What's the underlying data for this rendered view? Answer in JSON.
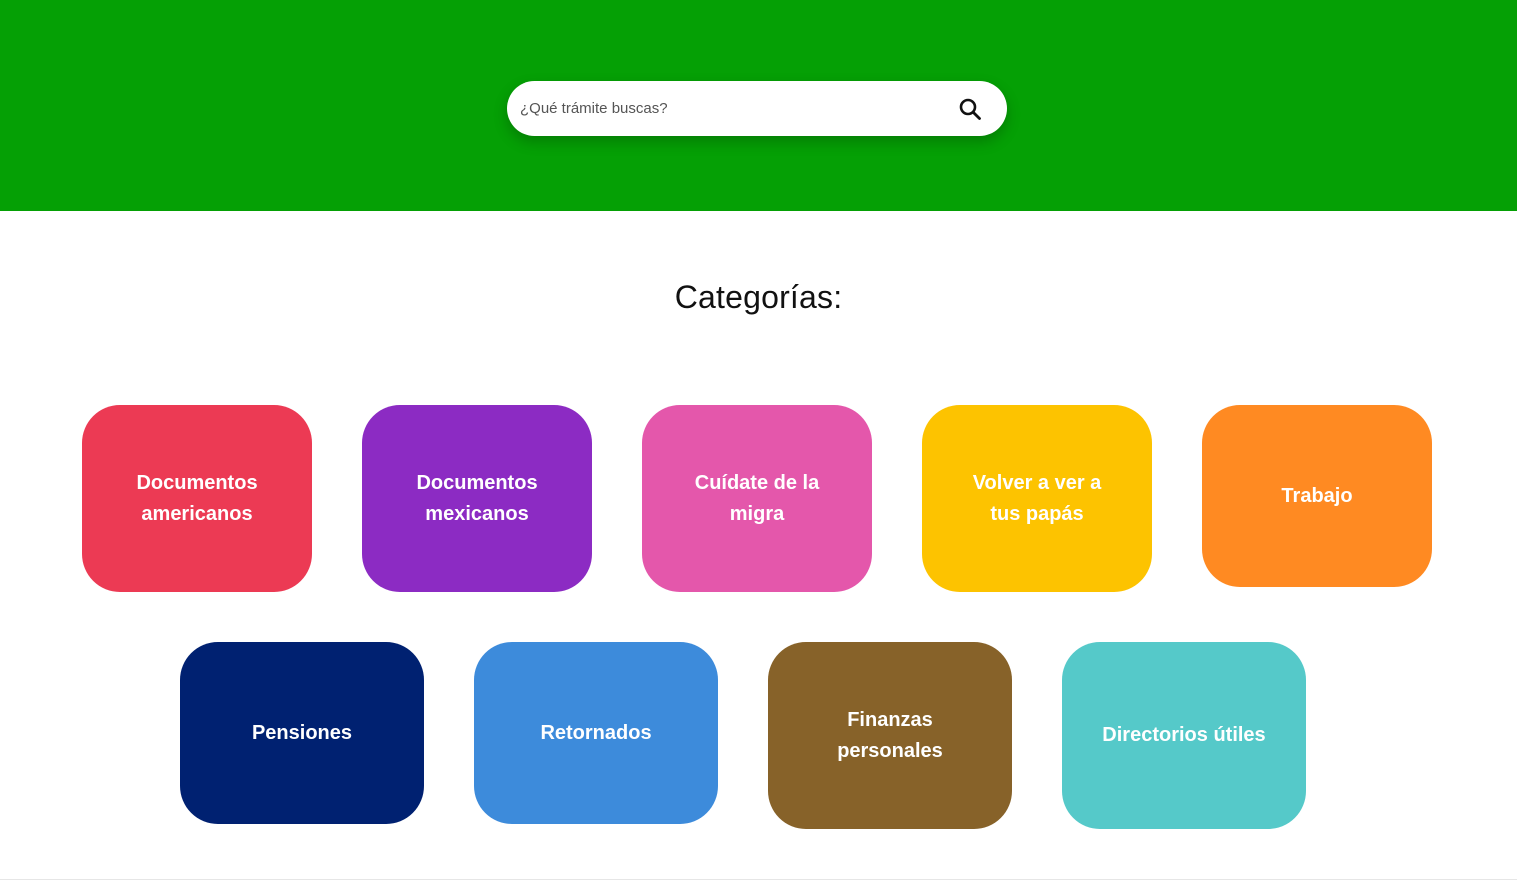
{
  "search": {
    "placeholder": "¿Qué trámite buscas?",
    "icon": "search-icon"
  },
  "section_title": "Categorías:",
  "categories": [
    {
      "label": "Documentos americanos",
      "color": "#ec3a54"
    },
    {
      "label": "Documentos mexicanos",
      "color": "#8c2bc3"
    },
    {
      "label": "Cuídate de la migra",
      "color": "#e457ab"
    },
    {
      "label": "Volver a ver a tus papás",
      "color": "#fdc300"
    },
    {
      "label": "Trabajo",
      "color": "#ff8a22"
    },
    {
      "label": "Pensiones",
      "color": "#002171"
    },
    {
      "label": "Retornados",
      "color": "#3d8bdb"
    },
    {
      "label": "Finanzas personales",
      "color": "#876229"
    },
    {
      "label": "Directorios útiles",
      "color": "#55c9c9"
    }
  ],
  "colors": {
    "hero": "#05a005",
    "background": "#ffffff"
  }
}
